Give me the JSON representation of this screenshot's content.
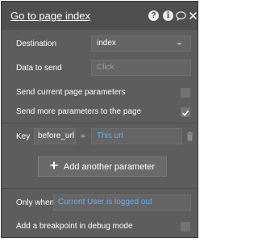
{
  "header": {
    "title": "Go to page index",
    "icons": [
      "help-icon",
      "info-icon",
      "comment-icon",
      "close-icon"
    ]
  },
  "rows": {
    "destination": {
      "label": "Destination",
      "value": "index"
    },
    "data_to_send": {
      "label": "Data to send",
      "placeholder": "Click"
    },
    "send_current": {
      "label": "Send current page parameters",
      "checked": false
    },
    "send_more": {
      "label": "Send more parameters to the page",
      "checked": true
    },
    "param": {
      "key_label": "Key",
      "key_value": "before_url",
      "equals": "=",
      "value": "This url"
    },
    "add_param": {
      "label": "Add another parameter"
    },
    "only_when": {
      "label": "Only when",
      "value": "Current User is logged out"
    },
    "breakpoint": {
      "label": "Add a breakpoint in debug mode",
      "checked": false
    }
  },
  "colors": {
    "panel_bg": "#5d5d5d",
    "header_bg": "#4f4f4f",
    "link_blue": "#67aef0",
    "placeholder": "#9a9a9a"
  }
}
